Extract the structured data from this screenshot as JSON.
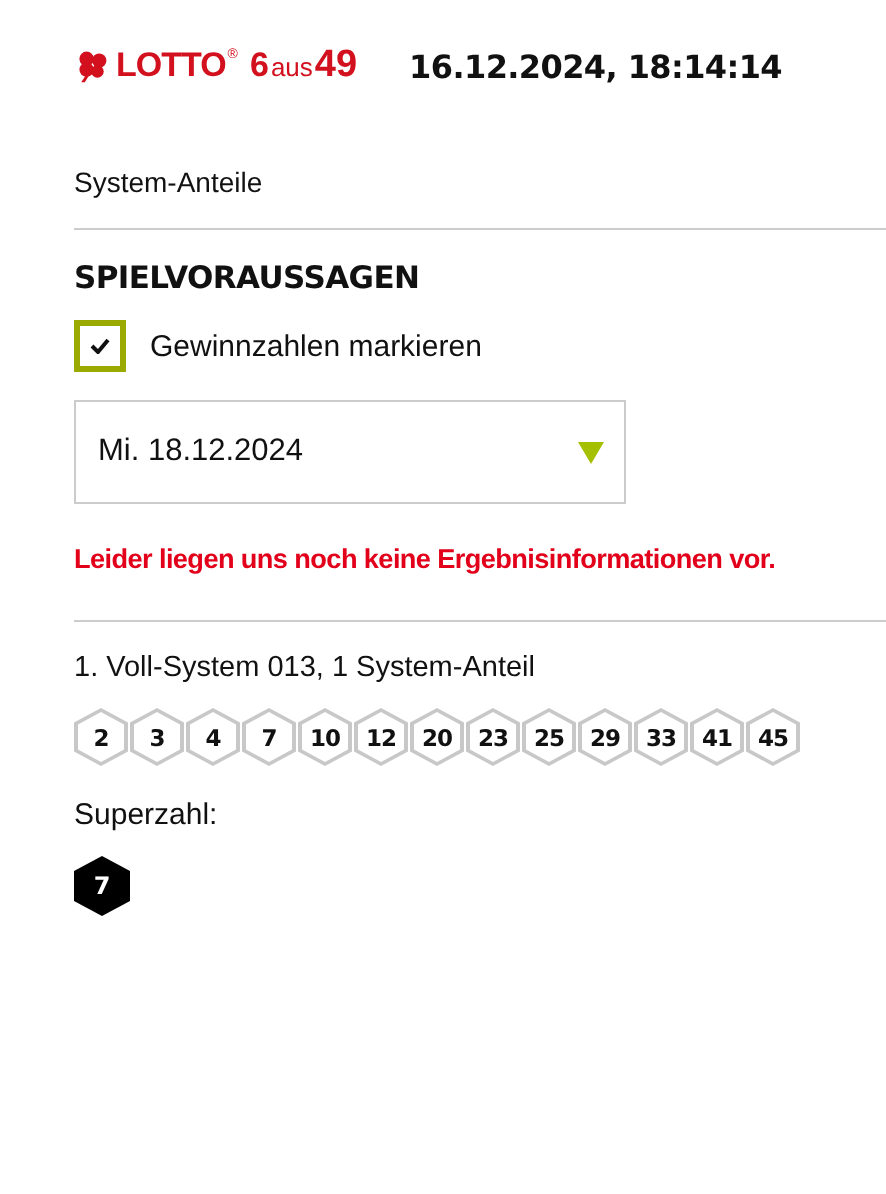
{
  "header": {
    "logo": {
      "brand": "LOTTO",
      "registered": "®",
      "game_number": "6",
      "game_word": "aus",
      "game_max": "49"
    },
    "timestamp": "16.12.2024, 18:14:14"
  },
  "section_title": "System-Anteile",
  "predictions": {
    "heading": "SPIELVORAUSSAGEN",
    "mark_winning": {
      "label": "Gewinnzahlen markieren",
      "checked": true
    },
    "draw_date": {
      "value": "Mi. 18.12.2024"
    },
    "error": "Leider liegen uns noch keine Ergebnisinformationen vor."
  },
  "tickets": [
    {
      "title": "1. Voll-System 013, 1 System-Anteil",
      "numbers": [
        "2",
        "3",
        "4",
        "7",
        "10",
        "12",
        "20",
        "23",
        "25",
        "29",
        "33",
        "41",
        "45"
      ],
      "superzahl": {
        "label": "Superzahl:",
        "number": "7"
      }
    }
  ]
}
